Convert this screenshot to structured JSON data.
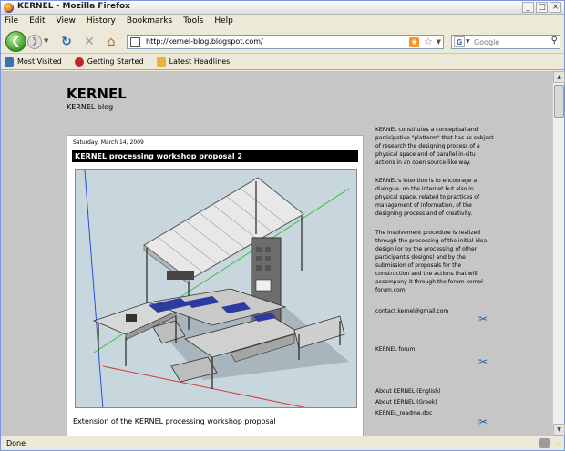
{
  "window": {
    "title": "KERNEL - Mozilla Firefox",
    "minimize": "_",
    "maximize": "□",
    "close": "×"
  },
  "menu": [
    "File",
    "Edit",
    "View",
    "History",
    "Bookmarks",
    "Tools",
    "Help"
  ],
  "nav": {
    "url": "http://kernel-blog.blogspot.com/",
    "search_placeholder": "Google"
  },
  "bookmarks": [
    "Most Visited",
    "Getting Started",
    "Latest Headlines"
  ],
  "blog": {
    "title": "KERNEL",
    "description": "KERNEL blog"
  },
  "post": {
    "date": "Saturday, March 14, 2009",
    "title": "KERNEL processing workshop proposal 2",
    "caption": "Extension of the KERNEL processing workshop proposal"
  },
  "sidebar": {
    "p1": "KERNEL constitutes a conceptual and participative \"platform\" that has as subject of research the designing process of a physical space and of parallel in-situ actions in an open source-like way.",
    "p2": "KERNEL's intention is to encourage a dialogue, on the internet but also in physical space, related to practices of management of information, of the designing process and of creativity.",
    "p3": "The involvement procedure is realized through the processing of the initial idea-design (or by the processing of other participant's designs) and by the submission of proposals for the construction and the actions that will accompany it through the forum kernel-forum.com.",
    "contact": "contact.kernel@gmail.com",
    "forum": "KERNEL forum",
    "links": [
      "About KERNEL (English)",
      "About KERNEL (Greek)",
      "KERNEL_readme.doc"
    ]
  },
  "status": {
    "text": "Done"
  },
  "colors": {
    "page_bg": "#c6c6c6",
    "title_bar": "#000000",
    "accent_link": "#2b5fa6"
  }
}
